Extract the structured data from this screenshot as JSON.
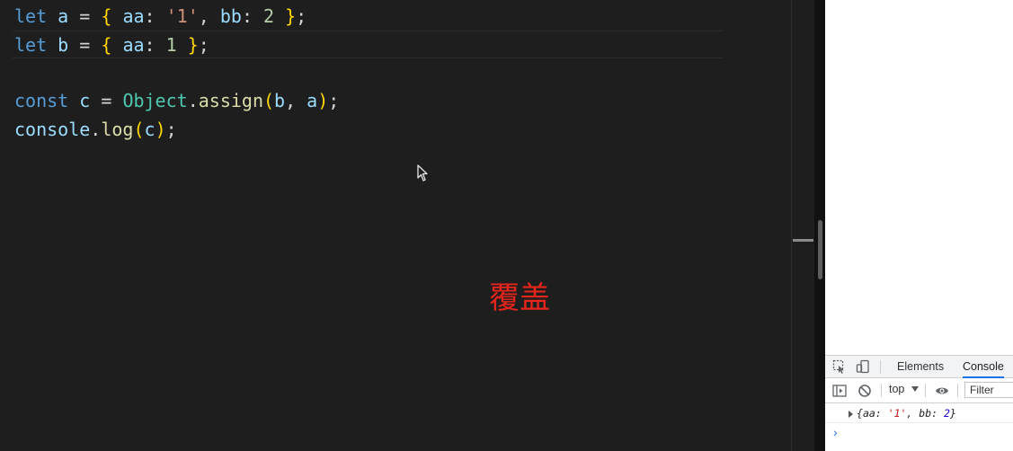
{
  "editor": {
    "lines": [
      [
        {
          "t": "let",
          "c": "kw"
        },
        {
          "t": " ",
          "c": "op"
        },
        {
          "t": "a",
          "c": "var"
        },
        {
          "t": " = ",
          "c": "op"
        },
        {
          "t": "{",
          "c": "brace"
        },
        {
          "t": " ",
          "c": "op"
        },
        {
          "t": "aa",
          "c": "var"
        },
        {
          "t": ": ",
          "c": "op"
        },
        {
          "t": "'1'",
          "c": "str"
        },
        {
          "t": ", ",
          "c": "punc"
        },
        {
          "t": "bb",
          "c": "var"
        },
        {
          "t": ": ",
          "c": "op"
        },
        {
          "t": "2",
          "c": "num"
        },
        {
          "t": " ",
          "c": "op"
        },
        {
          "t": "}",
          "c": "brace"
        },
        {
          "t": ";",
          "c": "punc"
        }
      ],
      [
        {
          "t": "let",
          "c": "kw"
        },
        {
          "t": " ",
          "c": "op"
        },
        {
          "t": "b",
          "c": "var"
        },
        {
          "t": " = ",
          "c": "op"
        },
        {
          "t": "{",
          "c": "brace"
        },
        {
          "t": " ",
          "c": "op"
        },
        {
          "t": "aa",
          "c": "var"
        },
        {
          "t": ": ",
          "c": "op"
        },
        {
          "t": "1",
          "c": "num"
        },
        {
          "t": " ",
          "c": "op"
        },
        {
          "t": "}",
          "c": "brace"
        },
        {
          "t": ";",
          "c": "punc"
        }
      ],
      [],
      [
        {
          "t": "const",
          "c": "kw"
        },
        {
          "t": " ",
          "c": "op"
        },
        {
          "t": "c",
          "c": "var"
        },
        {
          "t": " = ",
          "c": "op"
        },
        {
          "t": "Object",
          "c": "cls"
        },
        {
          "t": ".",
          "c": "punc"
        },
        {
          "t": "assign",
          "c": "fn"
        },
        {
          "t": "(",
          "c": "brace"
        },
        {
          "t": "b",
          "c": "var"
        },
        {
          "t": ", ",
          "c": "punc"
        },
        {
          "t": "a",
          "c": "var"
        },
        {
          "t": ")",
          "c": "brace"
        },
        {
          "t": ";",
          "c": "punc"
        }
      ],
      [
        {
          "t": "console",
          "c": "var"
        },
        {
          "t": ".",
          "c": "punc"
        },
        {
          "t": "log",
          "c": "fn"
        },
        {
          "t": "(",
          "c": "brace"
        },
        {
          "t": "c",
          "c": "var"
        },
        {
          "t": ")",
          "c": "brace"
        },
        {
          "t": ";",
          "c": "punc"
        }
      ]
    ]
  },
  "overlay_text": "覆盖",
  "devtools": {
    "tabs": [
      "Elements",
      "Console"
    ],
    "active_tab": "Console",
    "context": "top",
    "filter_placeholder": "Filter",
    "log": {
      "open": "{",
      "k1": "aa: ",
      "v1": "'1'",
      "sep": ", ",
      "k2": "bb: ",
      "v2": "2",
      "close": "}"
    },
    "prompt": "›"
  },
  "colors": {
    "editor_bg": "#1e1e1e",
    "keyword": "#569cd6",
    "variable": "#9cdcfe",
    "brace": "#ffd700",
    "string": "#ce9178",
    "number": "#b5cea8",
    "class": "#4ec9b0",
    "function": "#dcdcaa",
    "overlay": "#e8251c",
    "devtools_accent": "#1a73e8"
  },
  "icons": [
    "inspect-element-icon",
    "device-toggle-icon",
    "sidebar-toggle-icon",
    "clear-console-icon",
    "eye-icon",
    "mouse-pointer-icon"
  ]
}
